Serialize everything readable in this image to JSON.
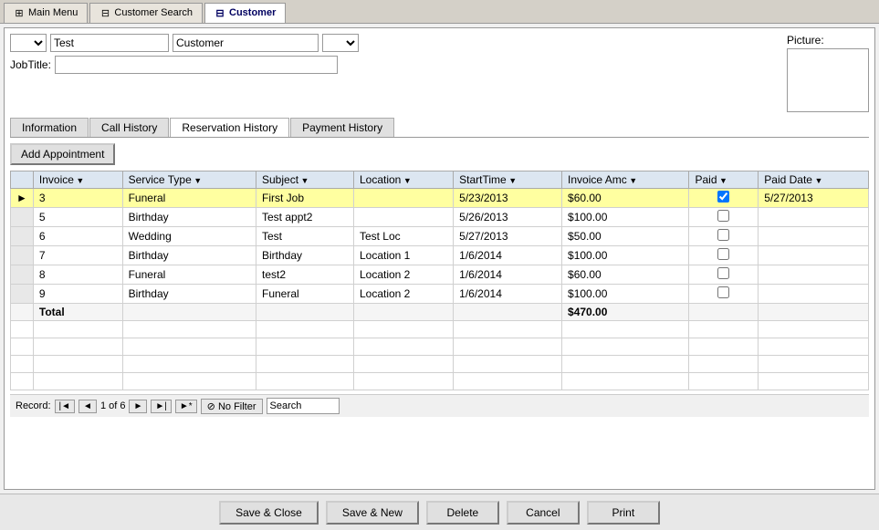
{
  "tabs": [
    {
      "id": "main-menu",
      "label": "Main Menu",
      "icon": "⊞",
      "active": false
    },
    {
      "id": "customer-search",
      "label": "Customer Search",
      "icon": "⊟",
      "active": false
    },
    {
      "id": "customer",
      "label": "Customer",
      "icon": "⊟",
      "active": true
    }
  ],
  "customer_form": {
    "prefix_dropdown": "",
    "first_name": "Test",
    "last_name_field": "Customer",
    "suffix_dropdown": "",
    "jobtitle_label": "JobTitle:",
    "jobtitle_value": "",
    "picture_label": "Picture:"
  },
  "inner_tabs": [
    {
      "id": "information",
      "label": "Information",
      "active": false
    },
    {
      "id": "call-history",
      "label": "Call History",
      "active": false
    },
    {
      "id": "reservation-history",
      "label": "Reservation History",
      "active": true
    },
    {
      "id": "payment-history",
      "label": "Payment History",
      "active": false
    }
  ],
  "add_appointment_label": "Add Appointment",
  "table": {
    "columns": [
      {
        "id": "invoice",
        "label": "Invoice"
      },
      {
        "id": "service-type",
        "label": "Service Type"
      },
      {
        "id": "subject",
        "label": "Subject"
      },
      {
        "id": "location",
        "label": "Location"
      },
      {
        "id": "start-time",
        "label": "StartTime"
      },
      {
        "id": "invoice-amount",
        "label": "Invoice Amc"
      },
      {
        "id": "paid",
        "label": "Paid"
      },
      {
        "id": "paid-date",
        "label": "Paid Date"
      }
    ],
    "rows": [
      {
        "invoice": "3",
        "service_type": "Funeral",
        "subject": "First Job",
        "location": "",
        "start_time": "5/23/2013",
        "invoice_amount": "$60.00",
        "paid": true,
        "paid_date": "5/27/2013",
        "selected": true
      },
      {
        "invoice": "5",
        "service_type": "Birthday",
        "subject": "Test appt2",
        "location": "",
        "start_time": "5/26/2013",
        "invoice_amount": "$100.00",
        "paid": false,
        "paid_date": "",
        "selected": false
      },
      {
        "invoice": "6",
        "service_type": "Wedding",
        "subject": "Test",
        "location": "Test Loc",
        "start_time": "5/27/2013",
        "invoice_amount": "$50.00",
        "paid": false,
        "paid_date": "",
        "selected": false
      },
      {
        "invoice": "7",
        "service_type": "Birthday",
        "subject": "Birthday",
        "location": "Location 1",
        "start_time": "1/6/2014",
        "invoice_amount": "$100.00",
        "paid": false,
        "paid_date": "",
        "selected": false
      },
      {
        "invoice": "8",
        "service_type": "Funeral",
        "subject": "test2",
        "location": "Location 2",
        "start_time": "1/6/2014",
        "invoice_amount": "$60.00",
        "paid": false,
        "paid_date": "",
        "selected": false
      },
      {
        "invoice": "9",
        "service_type": "Birthday",
        "subject": "Funeral",
        "location": "Location 2",
        "start_time": "1/6/2014",
        "invoice_amount": "$100.00",
        "paid": false,
        "paid_date": "",
        "selected": false
      }
    ],
    "total_label": "Total",
    "total_amount": "$470.00"
  },
  "nav_bar": {
    "record_label": "Record:",
    "current_record": "1",
    "total_records": "6",
    "no_filter_label": "No Filter",
    "search_placeholder": "Search",
    "search_value": "Search"
  },
  "bottom_buttons": [
    {
      "id": "save-close",
      "label": "Save & Close"
    },
    {
      "id": "save-new",
      "label": "Save & New"
    },
    {
      "id": "delete",
      "label": "Delete"
    },
    {
      "id": "cancel",
      "label": "Cancel"
    },
    {
      "id": "print",
      "label": "Print"
    }
  ]
}
